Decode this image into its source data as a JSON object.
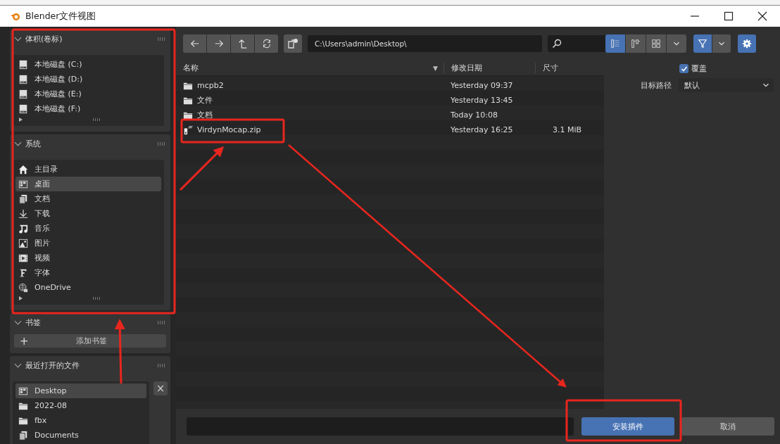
{
  "window": {
    "title": "Blender文件视图"
  },
  "sidebar": {
    "sections": [
      {
        "title": "体积(卷标)",
        "expanded": true,
        "items": [
          {
            "label": "本地磁盘 (C:)",
            "kind": "drive",
            "selected": false
          },
          {
            "label": "本地磁盘 (D:)",
            "kind": "drive",
            "selected": false
          },
          {
            "label": "本地磁盘 (E:)",
            "kind": "drive",
            "selected": false
          },
          {
            "label": "本地磁盘 (F:)",
            "kind": "drive",
            "selected": false
          }
        ]
      },
      {
        "title": "系统",
        "expanded": true,
        "items": [
          {
            "label": "主目录",
            "kind": "home",
            "selected": false
          },
          {
            "label": "桌面",
            "kind": "desktop",
            "selected": true
          },
          {
            "label": "文档",
            "kind": "documents",
            "selected": false
          },
          {
            "label": "下载",
            "kind": "download",
            "selected": false
          },
          {
            "label": "音乐",
            "kind": "music",
            "selected": false
          },
          {
            "label": "图片",
            "kind": "image",
            "selected": false
          },
          {
            "label": "视频",
            "kind": "video",
            "selected": false
          },
          {
            "label": "字体",
            "kind": "font",
            "selected": false
          },
          {
            "label": "OneDrive",
            "kind": "network",
            "selected": false
          }
        ]
      },
      {
        "title": "书签",
        "expanded": true,
        "add_button": {
          "icon": "+",
          "label": "添加书签"
        }
      },
      {
        "title": "最近打开的文件",
        "expanded": true,
        "clear_button": "×",
        "items": [
          {
            "label": "Desktop",
            "kind": "desktop",
            "selected": true
          },
          {
            "label": "2022-08",
            "kind": "folder",
            "selected": false
          },
          {
            "label": "fbx",
            "kind": "folder",
            "selected": false
          },
          {
            "label": "Documents",
            "kind": "documents",
            "selected": false
          }
        ]
      }
    ]
  },
  "toolbar": {
    "nav_buttons": [
      {
        "kind": "back"
      },
      {
        "kind": "forward"
      },
      {
        "kind": "parent"
      },
      {
        "kind": "refresh"
      }
    ],
    "path": "C:\\Users\\admin\\Desktop\\",
    "view_modes": [
      {
        "kind": "list",
        "selected": true
      },
      {
        "kind": "columns",
        "selected": false
      },
      {
        "kind": "thumbnails",
        "selected": false
      }
    ],
    "filter_on": true,
    "settings_on": true
  },
  "table": {
    "columns": [
      "名称",
      "修改日期",
      "尺寸"
    ],
    "sort_mark": "▼",
    "rows": [
      {
        "name": "mcpb2",
        "kind": "folder",
        "date": "Yesterday 09:37"
      },
      {
        "name": "文件",
        "kind": "folder",
        "date": "Yesterday 13:45"
      },
      {
        "name": "文档",
        "kind": "folder",
        "date": "Today 10:08"
      },
      {
        "name": "VirdynMocap.zip",
        "kind": "zip",
        "date": "Yesterday 16:25",
        "size": "3.1 MiB"
      }
    ]
  },
  "options": {
    "overwrite": {
      "label": "覆盖",
      "checked": true
    },
    "target_path": {
      "label": "目标路径",
      "value": "默认"
    }
  },
  "buttons": [
    {
      "label": "安装插件",
      "kind": "primary"
    },
    {
      "label": "取消",
      "kind": "secondary"
    }
  ]
}
